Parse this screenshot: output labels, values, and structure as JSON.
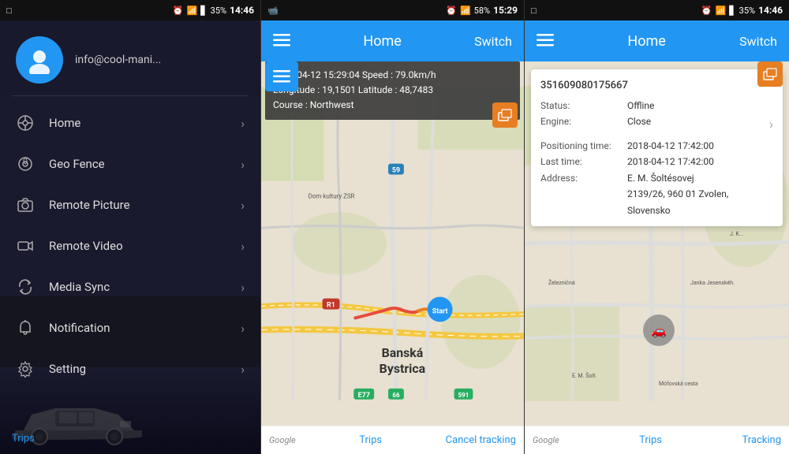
{
  "panel1": {
    "statusBar": {
      "left": "□",
      "time": "14:46",
      "battery": "35%"
    },
    "profile": {
      "email": "info@cool-mani...",
      "avatarIcon": "person"
    },
    "menuItems": [
      {
        "id": "home",
        "label": "Home",
        "icon": "location"
      },
      {
        "id": "geofence",
        "label": "Geo Fence",
        "icon": "fence"
      },
      {
        "id": "remotePicture",
        "label": "Remote Picture",
        "icon": "camera"
      },
      {
        "id": "remoteVideo",
        "label": "Remote Video",
        "icon": "video"
      },
      {
        "id": "mediaSync",
        "label": "Media Sync",
        "icon": "sync"
      },
      {
        "id": "notification",
        "label": "Notification",
        "icon": "bell"
      },
      {
        "id": "setting",
        "label": "Setting",
        "icon": "settings"
      }
    ],
    "footer": {
      "tripsLabel": "Trips"
    }
  },
  "panel2": {
    "statusBar": {
      "time": "15:29",
      "battery": "58%"
    },
    "header": {
      "title": "Home",
      "switchLabel": "Switch"
    },
    "infoOverlay": {
      "line1": "2018-04-12 15:29:04  Speed : 79.0km/h",
      "line2": "Longitude : 19,1501  Latitude : 48,7483",
      "line3": "Course : Northwest"
    },
    "footer": {
      "googleLabel": "Google",
      "tripsLabel": "Trips",
      "cancelTrackingLabel": "Cancel tracking"
    }
  },
  "panel3": {
    "statusBar": {
      "left": "□",
      "time": "14:46",
      "battery": "35%"
    },
    "header": {
      "title": "Home",
      "switchLabel": "Switch"
    },
    "infoCard": {
      "deviceId": "351609080175667",
      "status": {
        "label": "Status:",
        "value": "Offline"
      },
      "engine": {
        "label": "Engine:",
        "value": "Close"
      },
      "positioningTime": {
        "label": "Positioning time:",
        "value": "2018-04-12 17:42:00"
      },
      "lastTime": {
        "label": "Last time:",
        "value": "2018-04-12 17:42:00"
      },
      "address": {
        "label": "Address:",
        "value": "E. M. Šoltésovej\n2139/26, 960 01 Zvolen, Slovensko"
      }
    },
    "footer": {
      "googleLabel": "Google",
      "tripsLabel": "Trips",
      "trackingLabel": "Tracking"
    }
  }
}
